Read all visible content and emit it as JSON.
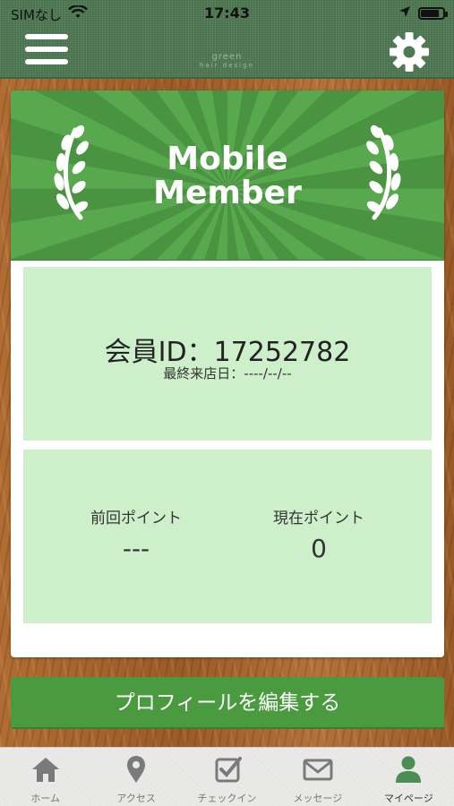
{
  "status_bar": {
    "carrier": "SIMなし",
    "time": "17:43"
  },
  "header": {
    "logo_text": "green",
    "logo_sub": "hair design",
    "menu_icon": "hamburger-menu-icon",
    "settings_icon": "gear-icon"
  },
  "card": {
    "title_line1": "Mobile",
    "title_line2": "Member",
    "member_id": "会員ID：17252782",
    "last_visit": "最終来店日：----/--/--",
    "prev_points_label": "前回ポイント",
    "prev_points_value": "---",
    "current_points_label": "現在ポイント",
    "current_points_value": "0"
  },
  "edit_profile_label": "プロフィールを編集する",
  "colors": {
    "header_green": "#4e7a52",
    "banner_green": "#4e9a45",
    "panel_green": "#cdf0ca",
    "button_green": "#4a9a40",
    "wood": "#a76730"
  },
  "tabs": [
    {
      "label": "ホーム",
      "icon": "home-icon"
    },
    {
      "label": "アクセス",
      "icon": "map-pin-icon"
    },
    {
      "label": "チェックイン",
      "icon": "checkbox-icon"
    },
    {
      "label": "メッセージ",
      "icon": "envelope-icon"
    },
    {
      "label": "マイページ",
      "icon": "person-icon",
      "active": true
    }
  ]
}
